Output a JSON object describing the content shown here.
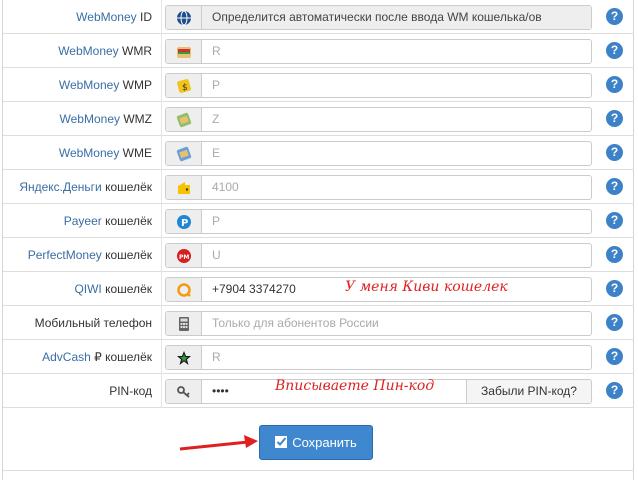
{
  "rows": [
    {
      "label_link": "WebMoney",
      "label_rest": " ID",
      "icon": "webmoney-globe-icon",
      "value": "Определится автоматически после ввода WM кошелька/ов",
      "kind": "readonly"
    },
    {
      "label_link": "WebMoney",
      "label_rest": " WMR",
      "icon": "wmr-wallet-icon",
      "placeholder": "R",
      "kind": "placeholder"
    },
    {
      "label_link": "WebMoney",
      "label_rest": " WMP",
      "icon": "wmp-wallet-icon",
      "placeholder": "P",
      "kind": "placeholder"
    },
    {
      "label_link": "WebMoney",
      "label_rest": " WMZ",
      "icon": "wmz-wallet-icon",
      "placeholder": "Z",
      "kind": "placeholder"
    },
    {
      "label_link": "WebMoney",
      "label_rest": " WME",
      "icon": "wme-wallet-icon",
      "placeholder": "E",
      "kind": "placeholder"
    },
    {
      "label_link": "Яндекс.Деньги",
      "label_rest": " кошелёк",
      "icon": "yandex-money-icon",
      "placeholder": "4100",
      "kind": "placeholder"
    },
    {
      "label_link": "Payeer",
      "label_rest": " кошелёк",
      "icon": "payeer-icon",
      "placeholder": "P",
      "kind": "placeholder"
    },
    {
      "label_link": "PerfectMoney",
      "label_rest": " кошелёк",
      "icon": "perfectmoney-icon",
      "placeholder": "U",
      "kind": "placeholder"
    },
    {
      "label_link": "QIWI",
      "label_rest": " кошелёк",
      "icon": "qiwi-icon",
      "value": "+7904 3374270",
      "kind": "value"
    },
    {
      "label_link": "",
      "label_rest": "Мобильный телефон",
      "icon": "calculator-icon",
      "placeholder": "Только для абонентов России",
      "kind": "placeholder"
    },
    {
      "label_link": "AdvCash",
      "label_rest": " ₽ кошелёк",
      "icon": "advcash-icon",
      "placeholder": "R",
      "kind": "placeholder"
    },
    {
      "label_link": "",
      "label_rest": "PIN-код",
      "icon": "key-icon",
      "value": "••••",
      "kind": "pin"
    }
  ],
  "help_label": "?",
  "annotations": {
    "qiwi_note": "У меня Киви кошелек",
    "pin_note": "Вписываете Пин-код"
  },
  "forgot_pin_label": "Забыли PIN-код?",
  "save_button_label": "Сохранить",
  "colors": {
    "link": "#3a6ea5",
    "help": "#3d82c8",
    "button": "#3f88cf",
    "annotation": "#e02020"
  }
}
